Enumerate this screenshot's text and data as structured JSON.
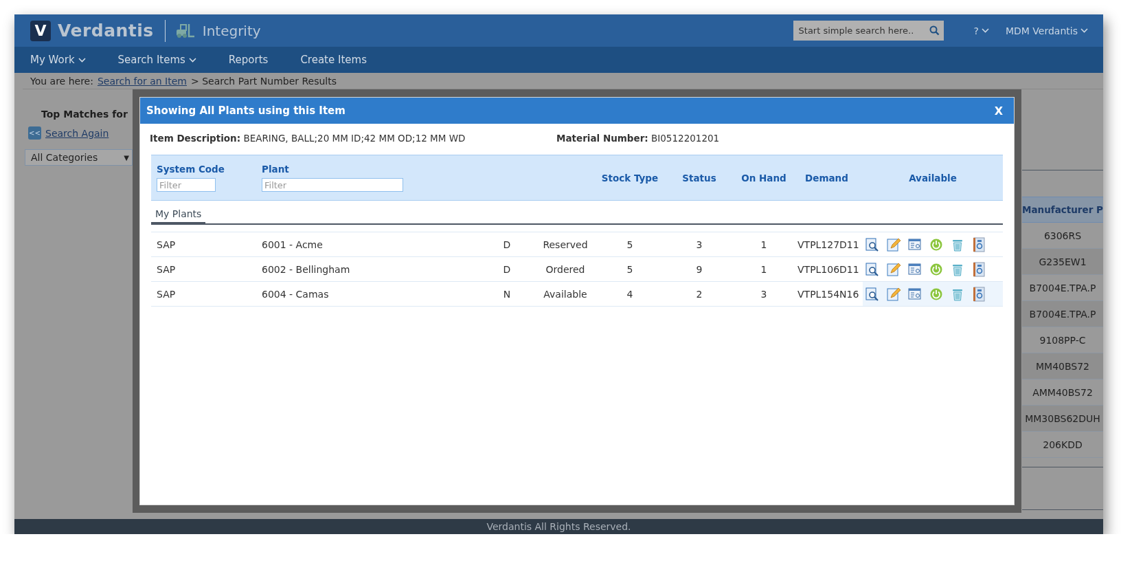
{
  "header": {
    "logo_letter": "V",
    "brand": "Verdantis",
    "product": "Integrity",
    "search": {
      "placeholder": "Start simple search here.."
    },
    "help": "?",
    "user": "MDM Verdantis"
  },
  "nav": [
    {
      "label": "My Work",
      "dropdown": true
    },
    {
      "label": "Search Items",
      "dropdown": true
    },
    {
      "label": "Reports",
      "dropdown": false
    },
    {
      "label": "Create Items",
      "dropdown": false
    }
  ],
  "breadcrumb": {
    "label": "You are here:",
    "link": "Search for an Item",
    "current": "> Search Part Number Results"
  },
  "sidebar": {
    "title": "Top Matches for",
    "back_button": "<<",
    "back_link": "Search Again",
    "category_select": {
      "value": "All Categories",
      "arrow": "▼"
    }
  },
  "results_table": {
    "column": "Manufacturer P",
    "cells": [
      "6306RS",
      "G235EW1",
      "B7004E.TPA.P",
      "B7004E.TPA.P",
      "9108PP-C",
      "MM40BS72",
      "AMM40BS72",
      "MM30BS62DUH",
      "206KDD"
    ]
  },
  "dialog": {
    "title": "Showing All Plants using this Item",
    "close": "X",
    "item_description": {
      "label": "Item Description:",
      "value": "BEARING, BALL;20 MM ID;42 MM OD;12 MM WD"
    },
    "material_number": {
      "label": "Material Number:",
      "value": "BI0512201201"
    },
    "columns": [
      {
        "label": "System Code",
        "filter": {
          "placeholder": "Filter"
        }
      },
      {
        "label": "Plant",
        "filter": {
          "placeholder": "Filter"
        }
      },
      {},
      {},
      {
        "label": "Stock Type"
      },
      {
        "label": "Status"
      },
      {
        "label": "On Hand"
      },
      {
        "label": "Demand"
      },
      {
        "label": "Available"
      }
    ],
    "tabs": [
      {
        "label": "My Plants",
        "selected": true
      }
    ],
    "rows": [
      {
        "selected": false,
        "cells": [
          "SAP",
          "6001 - Acme",
          "D",
          "Reserved",
          "5",
          "3",
          "1",
          "VTPL127D11"
        ]
      },
      {
        "selected": false,
        "cells": [
          "SAP",
          "6002 - Bellingham",
          "D",
          "Ordered",
          "5",
          "9",
          "1",
          "VTPL106D11"
        ]
      },
      {
        "selected": true,
        "cells": [
          "SAP",
          "6004 - Camas",
          "N",
          "Available",
          "4",
          "2",
          "3",
          "VTPL154N16"
        ]
      }
    ]
  },
  "footer": "Verdantis All Rights Reserved."
}
